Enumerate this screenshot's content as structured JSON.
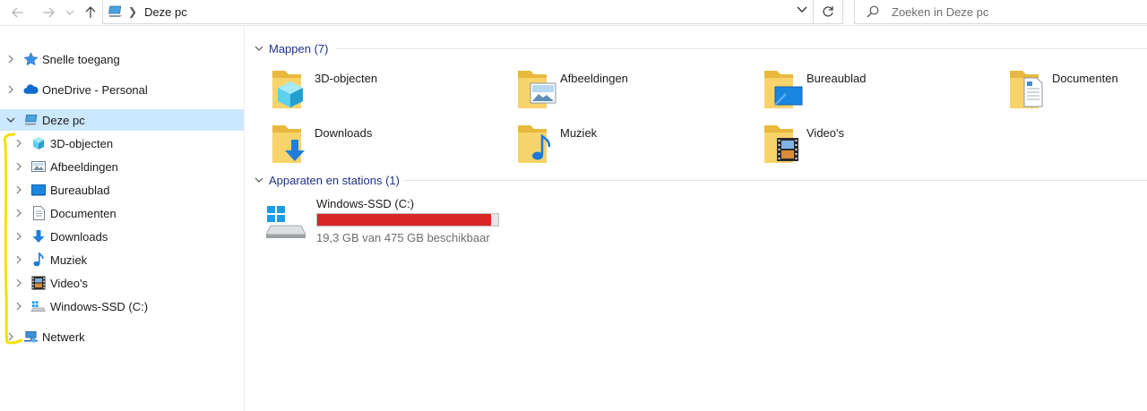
{
  "address_bar": {
    "path_label": "Deze pc",
    "search_placeholder": "Zoeken in Deze pc"
  },
  "sidebar": {
    "items": [
      {
        "label": "Snelle toegang",
        "icon": "star-icon"
      },
      {
        "label": "OneDrive - Personal",
        "icon": "cloud-icon"
      },
      {
        "label": "Deze pc",
        "icon": "computer-icon",
        "selected": true,
        "expanded": true
      },
      {
        "label": "3D-objecten",
        "icon": "3d-objects-icon"
      },
      {
        "label": "Afbeeldingen",
        "icon": "pictures-icon"
      },
      {
        "label": "Bureaublad",
        "icon": "desktop-icon"
      },
      {
        "label": "Documenten",
        "icon": "documents-icon"
      },
      {
        "label": "Downloads",
        "icon": "downloads-icon"
      },
      {
        "label": "Muziek",
        "icon": "music-icon"
      },
      {
        "label": "Video's",
        "icon": "videos-icon"
      },
      {
        "label": "Windows-SSD (C:)",
        "icon": "drive-icon"
      },
      {
        "label": "Netwerk",
        "icon": "network-icon"
      }
    ]
  },
  "main": {
    "folders_header": "Mappen (7)",
    "folders": [
      {
        "label": "3D-objecten",
        "icon": "3d-objects-folder-icon"
      },
      {
        "label": "Afbeeldingen",
        "icon": "pictures-folder-icon"
      },
      {
        "label": "Bureaublad",
        "icon": "desktop-folder-icon"
      },
      {
        "label": "Documenten",
        "icon": "documents-folder-icon"
      },
      {
        "label": "Downloads",
        "icon": "downloads-folder-icon"
      },
      {
        "label": "Muziek",
        "icon": "music-folder-icon"
      },
      {
        "label": "Video's",
        "icon": "videos-folder-icon"
      }
    ],
    "devices_header": "Apparaten en stations (1)",
    "drive": {
      "name": "Windows-SSD (C:)",
      "free_text": "19,3 GB van 475 GB beschikbaar",
      "used_fraction": 0.959,
      "bar_color": "#da2626"
    }
  },
  "colors": {
    "selection": "#cce8ff",
    "group_header": "#1e3287",
    "annotation": "#f5e000"
  }
}
